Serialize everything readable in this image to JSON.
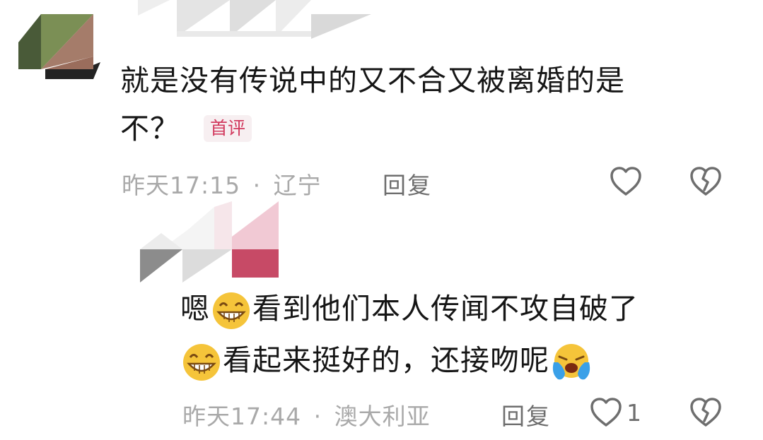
{
  "comments": [
    {
      "text_line1": "就是没有传说中的又不合又被离婚的是",
      "text_line2": "不？",
      "badge": "首评",
      "time": "昨天17:15",
      "separator": "·",
      "location": "辽宁",
      "reply_label": "回复",
      "like_count": "",
      "like_icon": "heart-outline",
      "dislike_icon": "broken-heart-outline"
    },
    {
      "text_line1_prefix": "嗯",
      "text_line1_emoji": "grinning-face",
      "text_line1_rest": "看到他们本人传闻不攻自破了",
      "text_line2_emoji": "grinning-face",
      "text_line2_rest": "看起来挺好的，还接吻呢",
      "text_line2_tail_emoji": "crying-face",
      "time": "昨天17:44",
      "separator": "·",
      "location": "澳大利亚",
      "reply_label": "回复",
      "like_count": "1",
      "like_icon": "heart-outline",
      "dislike_icon": "broken-heart-outline"
    }
  ],
  "colors": {
    "badge_text": "#d23a5e",
    "badge_bg": "#f7eff1",
    "meta": "#a9a9a9",
    "icon": "#6e6e6e"
  }
}
